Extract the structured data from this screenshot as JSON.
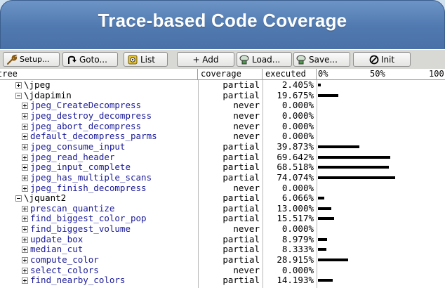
{
  "title": "Trace-based Code Coverage",
  "toolbar": {
    "setup": "Setup...",
    "goto": "Goto...",
    "list": "List",
    "add": "+ Add",
    "load": "Load...",
    "save": "Save...",
    "init": "Init"
  },
  "columns": {
    "tree": "tree",
    "coverage": "coverage",
    "executed": "executed",
    "scale_0": "0%",
    "scale_50": "50%",
    "scale_100": "100"
  },
  "rows": [
    {
      "name": "\\jpeg",
      "level": 0,
      "expander": "plus",
      "coverage": "partial",
      "executed": "2.405%",
      "pct": 2.405
    },
    {
      "name": "\\jdapimin",
      "level": 0,
      "expander": "minus",
      "coverage": "partial",
      "executed": "19.675%",
      "pct": 19.675
    },
    {
      "name": "jpeg_CreateDecompress",
      "level": 1,
      "expander": "plus",
      "coverage": "never",
      "executed": "0.000%",
      "pct": 0
    },
    {
      "name": "jpeg_destroy_decompress",
      "level": 1,
      "expander": "plus",
      "coverage": "never",
      "executed": "0.000%",
      "pct": 0
    },
    {
      "name": "jpeg_abort_decompress",
      "level": 1,
      "expander": "plus",
      "coverage": "never",
      "executed": "0.000%",
      "pct": 0
    },
    {
      "name": "default_decompress_parms",
      "level": 1,
      "expander": "plus",
      "coverage": "never",
      "executed": "0.000%",
      "pct": 0
    },
    {
      "name": "jpeg_consume_input",
      "level": 1,
      "expander": "plus",
      "coverage": "partial",
      "executed": "39.873%",
      "pct": 39.873
    },
    {
      "name": "jpeg_read_header",
      "level": 1,
      "expander": "plus",
      "coverage": "partial",
      "executed": "69.642%",
      "pct": 69.642
    },
    {
      "name": "jpeg_input_complete",
      "level": 1,
      "expander": "plus",
      "coverage": "partial",
      "executed": "68.518%",
      "pct": 68.518
    },
    {
      "name": "jpeg_has_multiple_scans",
      "level": 1,
      "expander": "plus",
      "coverage": "partial",
      "executed": "74.074%",
      "pct": 74.074
    },
    {
      "name": "jpeg_finish_decompress",
      "level": 1,
      "expander": "plus",
      "coverage": "never",
      "executed": "0.000%",
      "pct": 0
    },
    {
      "name": "\\jquant2",
      "level": 0,
      "expander": "minus",
      "coverage": "partial",
      "executed": "6.066%",
      "pct": 6.066
    },
    {
      "name": "prescan_quantize",
      "level": 1,
      "expander": "plus",
      "coverage": "partial",
      "executed": "13.000%",
      "pct": 13.0
    },
    {
      "name": "find_biggest_color_pop",
      "level": 1,
      "expander": "plus",
      "coverage": "partial",
      "executed": "15.517%",
      "pct": 15.517
    },
    {
      "name": "find_biggest_volume",
      "level": 1,
      "expander": "plus",
      "coverage": "never",
      "executed": "0.000%",
      "pct": 0
    },
    {
      "name": "update_box",
      "level": 1,
      "expander": "plus",
      "coverage": "partial",
      "executed": "8.979%",
      "pct": 8.979
    },
    {
      "name": "median_cut",
      "level": 1,
      "expander": "plus",
      "coverage": "partial",
      "executed": "8.333%",
      "pct": 8.333
    },
    {
      "name": "compute_color",
      "level": 1,
      "expander": "plus",
      "coverage": "partial",
      "executed": "28.915%",
      "pct": 28.915
    },
    {
      "name": "select_colors",
      "level": 1,
      "expander": "plus",
      "coverage": "never",
      "executed": "0.000%",
      "pct": 0
    },
    {
      "name": "find_nearby_colors",
      "level": 1,
      "expander": "plus",
      "coverage": "partial",
      "executed": "14.193%",
      "pct": 14.193
    }
  ],
  "colors": {
    "title_bg": "#5079b0",
    "toolbar_bg": "#d8d8d4",
    "tree_text": "#1a1a99",
    "bar": "#000000"
  }
}
